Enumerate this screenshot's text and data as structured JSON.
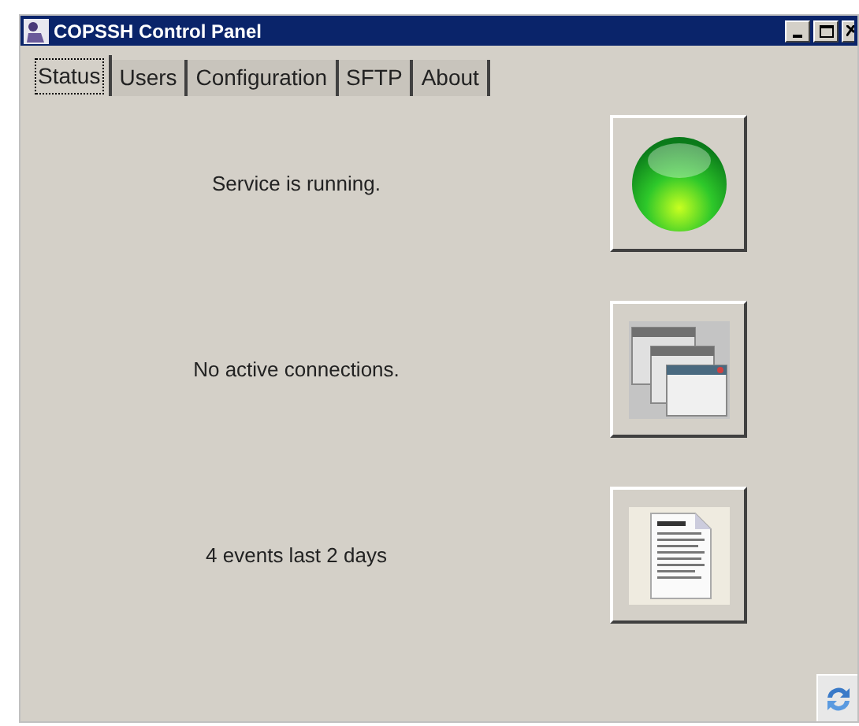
{
  "window": {
    "title": "COPSSH Control Panel"
  },
  "tabs": [
    {
      "label": "Status",
      "selected": true
    },
    {
      "label": "Users",
      "selected": false
    },
    {
      "label": "Configuration",
      "selected": false
    },
    {
      "label": "SFTP",
      "selected": false
    },
    {
      "label": "About",
      "selected": false
    }
  ],
  "status_rows": [
    {
      "text": "Service is running.",
      "kind": "service"
    },
    {
      "text": "No active connections.",
      "kind": "connections"
    },
    {
      "text": "4 events last 2 days",
      "kind": "events"
    }
  ]
}
